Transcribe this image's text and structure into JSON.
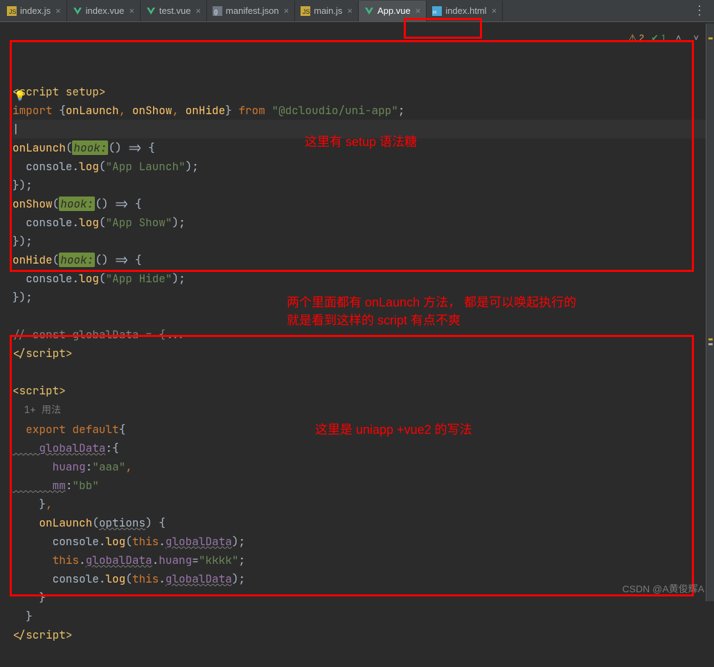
{
  "tabs": [
    {
      "label": "index.js",
      "icon": "js"
    },
    {
      "label": "index.vue",
      "icon": "vue"
    },
    {
      "label": "test.vue",
      "icon": "vue"
    },
    {
      "label": "manifest.json",
      "icon": "json"
    },
    {
      "label": "main.js",
      "icon": "js"
    },
    {
      "label": "App.vue",
      "icon": "vue",
      "active": true
    },
    {
      "label": "index.html",
      "icon": "html"
    }
  ],
  "status": {
    "warnings": "2",
    "passed": "1"
  },
  "code": {
    "l1a": "<",
    "l1b": "script setup",
    "l1c": ">",
    "l2a": "import ",
    "l2b": "{",
    "l2c": "onLaunch",
    "l2d": ", ",
    "l2e": "onShow",
    "l2f": ", ",
    "l2g": "onHide",
    "l2h": "}",
    "l2i": " from ",
    "l2j": "\"@dcloudio/uni-app\"",
    "l2k": ";",
    "l3": "",
    "l4a": "onLaunch",
    "l4b": "(",
    "l4c": "hook:",
    "l4d": "() ",
    "l4e": "=>",
    "l4f": " {",
    "l5a": "  console",
    "l5b": ".",
    "l5c": "log",
    "l5d": "(",
    "l5e": "\"App Launch\"",
    "l5f": ")",
    "l5g": ";",
    "l6a": "}",
    "l6b": ")",
    "l6c": ";",
    "l7a": "onShow",
    "l7b": "(",
    "l7c": "hook:",
    "l7d": "() ",
    "l7e": "=>",
    "l7f": " {",
    "l8a": "  console",
    "l8b": ".",
    "l8c": "log",
    "l8d": "(",
    "l8e": "\"App Show\"",
    "l8f": ")",
    "l8g": ";",
    "l9a": "}",
    "l9b": ")",
    "l9c": ";",
    "l10a": "onHide",
    "l10b": "(",
    "l10c": "hook:",
    "l10d": "() ",
    "l10e": "=>",
    "l10f": " {",
    "l11a": "  console",
    "l11b": ".",
    "l11c": "log",
    "l11d": "(",
    "l11e": "\"App Hide\"",
    "l11f": ")",
    "l11g": ";",
    "l12a": "}",
    "l12b": ")",
    "l12c": ";",
    "l13": "",
    "l14": "// const globalData = {...",
    "l15a": "</",
    "l15b": "script",
    "l15c": ">",
    "l16": "",
    "l17a": "<",
    "l17b": "script",
    "l17c": ">",
    "l18": "  1+ 用法",
    "l19a": "  export ",
    "l19b": "default",
    "l19c": "{",
    "l20a": "    globalData",
    "l20b": ":",
    "l20c": "{",
    "l21a": "      huang",
    "l21b": ":",
    "l21c": "\"aaa\"",
    "l21d": ",",
    "l22a": "      mm",
    "l22b": ":",
    "l22c": "\"bb\"",
    "l23a": "    }",
    "l23b": ",",
    "l24a": "    onLaunch",
    "l24b": "(",
    "l24c": "options",
    "l24d": ")",
    "l24e": " {",
    "l25a": "      console",
    "l25b": ".",
    "l25c": "log",
    "l25d": "(",
    "l25e": "this",
    "l25f": ".",
    "l25g": "globalData",
    "l25h": ")",
    "l25i": ";",
    "l26a": "      this",
    "l26b": ".",
    "l26c": "globalData",
    "l26d": ".",
    "l26e": "huang",
    "l26f": "=",
    "l26g": "\"kkkk\"",
    "l26h": ";",
    "l27a": "      console",
    "l27b": ".",
    "l27c": "log",
    "l27d": "(",
    "l27e": "this",
    "l27f": ".",
    "l27g": "globalData",
    "l27h": ")",
    "l27i": ";",
    "l28": "    }",
    "l29": "  }",
    "l30a": "</",
    "l30b": "script",
    "l30c": ">"
  },
  "annotations": {
    "a1": "这里有 setup 语法糖",
    "a2_l1": "两个里面都有 onLaunch 方法，  都是可以唤起执行的",
    "a2_l2": "就是看到这样的 script 有点不爽",
    "a3": "这里是 uniapp +vue2 的写法"
  },
  "watermark": "CSDN @A黄俊辉A"
}
